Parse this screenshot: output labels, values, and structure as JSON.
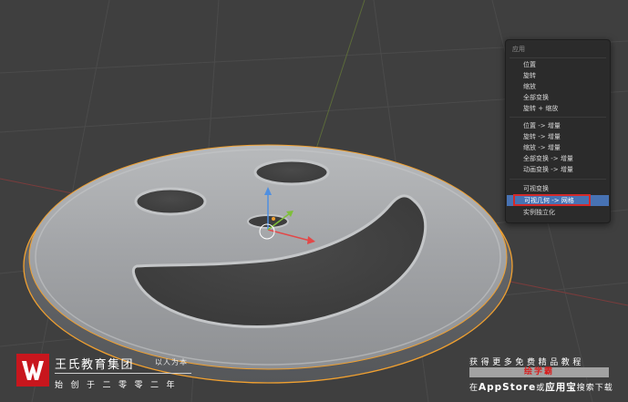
{
  "menu": {
    "title": "应用",
    "items": [
      "位置",
      "旋转",
      "缩放",
      "全部变换",
      "旋转 + 缩放",
      "位置 -> 增量",
      "旋转 -> 增量",
      "缩放 -> 增量",
      "全部变换 -> 增量",
      "动画变换 -> 增量",
      "可视变换",
      "可视几何 -> 网格",
      "实例独立化"
    ],
    "active_index": 11
  },
  "brand": {
    "name": "王氏教育集团",
    "motto": "以人为本",
    "since": "始创于二零零二年"
  },
  "promo": {
    "line1": "获得更多免费精品教程",
    "line2": "绘学霸",
    "line3_prefix": "在",
    "line3_app1": "AppStore",
    "line3_mid": "或",
    "line3_app2": "应用宝",
    "line3_suffix": "搜索下载"
  },
  "colors": {
    "viewport_bg": "#3f3f3f",
    "menu_bg": "#2b2b2b",
    "menu_active": "#4772b3",
    "selection_outline": "#f0a030",
    "highlight_box": "#d32a2a",
    "logo_red": "#c8161d"
  }
}
